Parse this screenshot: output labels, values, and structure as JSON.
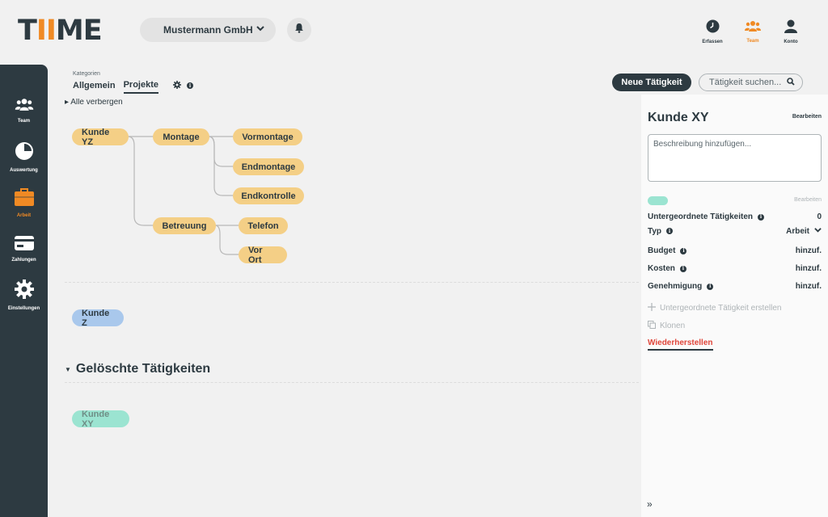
{
  "app": {
    "logo_prefix": "T",
    "logo_ii": "II",
    "logo_suffix": "ME",
    "company": "Mustermann GmbH"
  },
  "topnav": [
    {
      "label": "Erfassen",
      "icon": "clock-icon"
    },
    {
      "label": "Team",
      "icon": "team-icon",
      "active": true
    },
    {
      "label": "Konto",
      "icon": "user-icon"
    }
  ],
  "sidebar": [
    {
      "label": "Team",
      "icon": "team-icon"
    },
    {
      "label": "Auswertung",
      "icon": "pie-chart-icon"
    },
    {
      "label": "Arbeit",
      "icon": "briefcase-icon",
      "active": true
    },
    {
      "label": "Zahlungen",
      "icon": "payment-card-icon"
    },
    {
      "label": "Einstellungen",
      "icon": "gear-icon"
    }
  ],
  "categories": {
    "title": "Kategorien",
    "tabs": [
      "Allgemein",
      "Projekte"
    ],
    "active_tab": "Projekte"
  },
  "actions": {
    "new_activity": "Neue Tätigkeit",
    "search_placeholder": "Tätigkeit suchen..."
  },
  "tree": {
    "hide_all": "Alle verbergen",
    "nodes": [
      "Kunde YZ",
      "Montage",
      "Vormontage",
      "Endmontage",
      "Endkontrolle",
      "Betreuung",
      "Telefon",
      "Vor Ort"
    ],
    "kunde_z": "Kunde Z",
    "deleted_heading": "Gelöschte Tätigkeiten",
    "deleted_node": "Kunde XY"
  },
  "panel": {
    "title": "Kunde XY",
    "edit": "Bearbeiten",
    "desc_placeholder": "Beschreibung hinzufügen...",
    "edit_color": "Bearbeiten",
    "color": "#9be4d1",
    "rows": {
      "sub": {
        "label": "Untergeordnete Tätigkeiten",
        "value": "0"
      },
      "type": {
        "label": "Typ",
        "value": "Arbeit"
      },
      "budget": {
        "label": "Budget",
        "value": "hinzuf."
      },
      "cost": {
        "label": "Kosten",
        "value": "hinzuf."
      },
      "approval": {
        "label": "Genehmigung",
        "value": "hinzuf."
      }
    },
    "create_sub": "Untergeordnete Tätigkeit erstellen",
    "clone": "Klonen",
    "restore": "Wiederherstellen",
    "collapse": "»"
  }
}
